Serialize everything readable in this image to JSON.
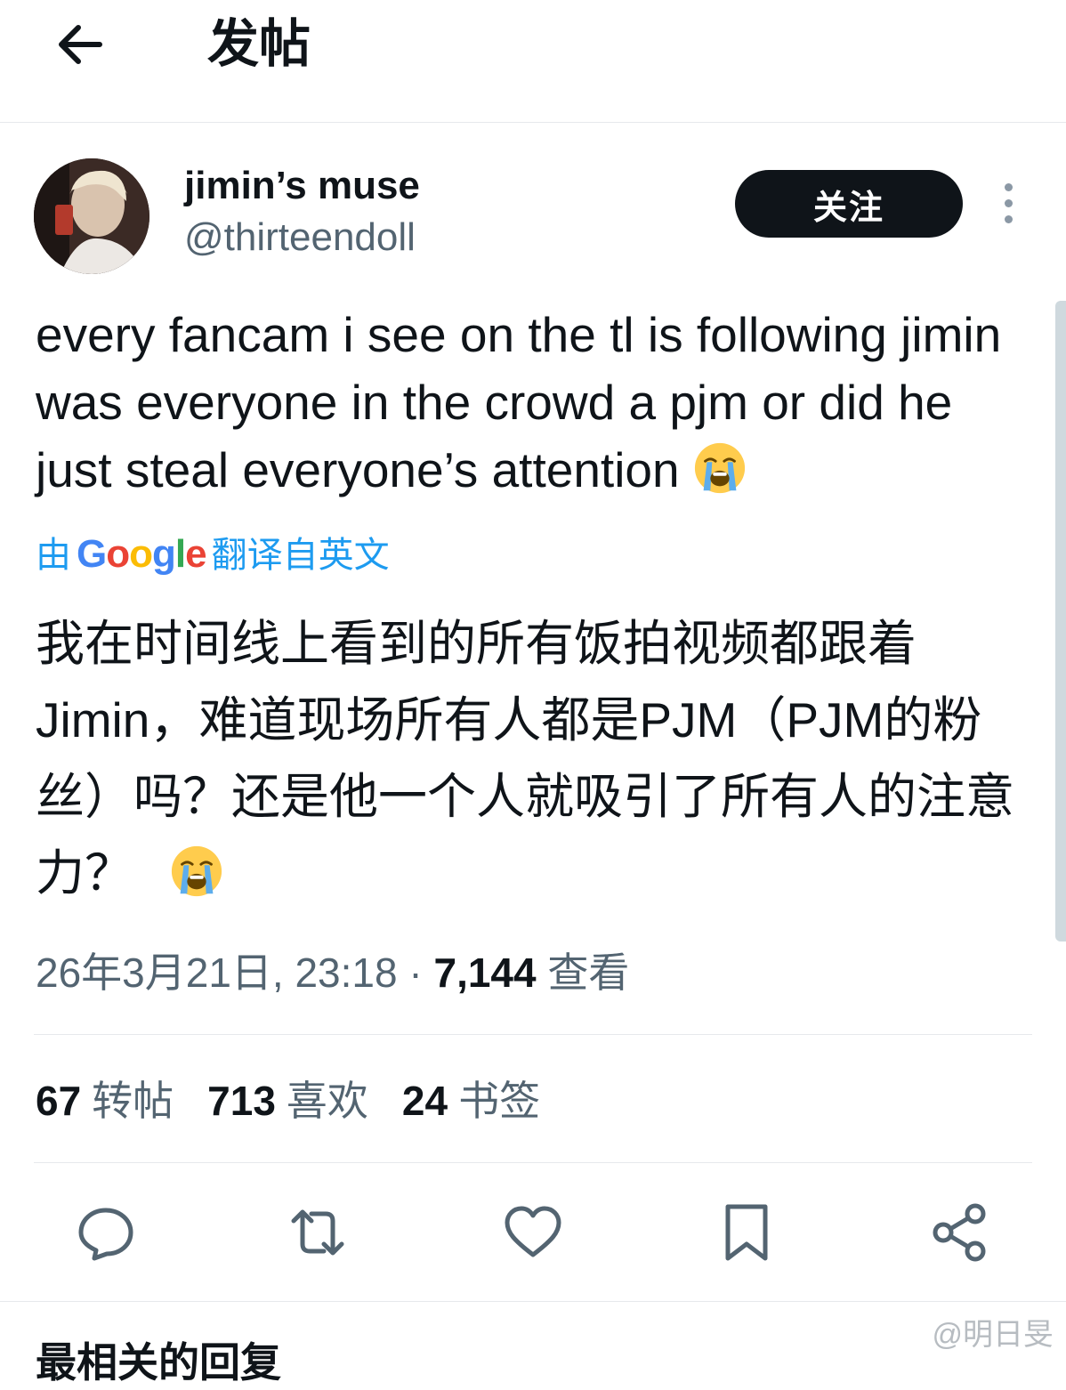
{
  "header": {
    "title": "发帖",
    "back_icon": "arrow-left-icon"
  },
  "author": {
    "display_name": "jimin’s muse",
    "handle": "@thirteendoll",
    "follow_label": "关注"
  },
  "tweet": {
    "text_en": "every fancam i see on the tl is following jimin was everyone in the crowd a pjm or did he just steal everyone’s attention",
    "emoji_en": "loudly-crying-face",
    "translated_prefix": "由",
    "translated_brand": [
      "G",
      "o",
      "o",
      "g",
      "l",
      "e"
    ],
    "translated_suffix": "翻译自英文",
    "text_zh": "我在时间线上看到的所有饭拍视频都跟着Jimin，难道现场所有人都是PJM（PJM的粉丝）吗？还是他一个人就吸引了所有人的注意力？",
    "emoji_zh": "loudly-crying-face"
  },
  "meta": {
    "timestamp": "26年3月21日, 23:18",
    "separator": "·",
    "views": "7,144",
    "views_label": "查看"
  },
  "stats": {
    "reposts": "67",
    "reposts_label": "转帖",
    "likes": "713",
    "likes_label": "喜欢",
    "bookmarks": "24",
    "bookmarks_label": "书签"
  },
  "actions": [
    "reply-icon",
    "repost-icon",
    "like-icon",
    "bookmark-icon",
    "share-icon"
  ],
  "related": {
    "heading": "最相关的回复"
  },
  "watermark": "@明日旻",
  "colors": {
    "text": "#0f1419",
    "secondary": "#536471",
    "link": "#1d9bf0",
    "button_bg": "#0f1419",
    "divider": "#e6e9ec"
  }
}
